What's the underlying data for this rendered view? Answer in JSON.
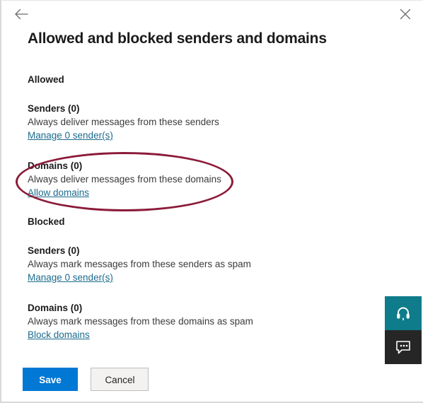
{
  "window": {
    "title": "Allowed and blocked senders and domains",
    "back_icon": "arrow-left-icon",
    "close_icon": "close-icon"
  },
  "sections": [
    {
      "heading": "Allowed",
      "blocks": [
        {
          "title": "Senders (0)",
          "description": "Always deliver messages from these senders",
          "link": "Manage 0 sender(s)"
        },
        {
          "title": "Domains (0)",
          "description": "Always deliver messages from these domains",
          "link": "Allow domains"
        }
      ]
    },
    {
      "heading": "Blocked",
      "blocks": [
        {
          "title": "Senders (0)",
          "description": "Always mark messages from these senders as spam",
          "link": "Manage 0 sender(s)"
        },
        {
          "title": "Domains (0)",
          "description": "Always mark messages from these domains as spam",
          "link": "Block domains"
        }
      ]
    }
  ],
  "annotation": {
    "type": "ellipse-highlight",
    "color": "#8c1b3a",
    "targets": "allowed-domains-block"
  },
  "side_widgets": [
    {
      "name": "support",
      "icon": "headset-icon",
      "color": "#0e7c8a"
    },
    {
      "name": "feedback",
      "icon": "chat-bubble-icon",
      "color": "#262626"
    }
  ],
  "footer": {
    "save_label": "Save",
    "cancel_label": "Cancel",
    "save_color": "#0078d4"
  },
  "colors": {
    "link": "#1b6b8d",
    "text": "#1b1b1b",
    "muted_text": "#3b3b3b"
  }
}
